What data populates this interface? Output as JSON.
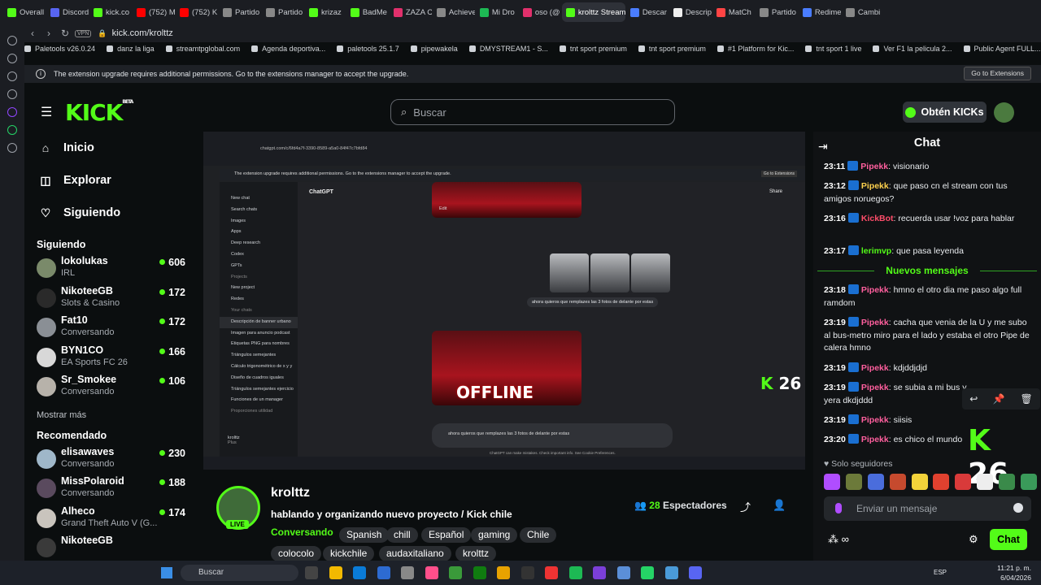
{
  "browser": {
    "tabs": [
      "Overall",
      "Discord",
      "kick.co",
      "(752) M",
      "(752) K",
      "Partido",
      "Partido",
      "krizaz",
      "BadMe",
      "ZAZA C",
      "Achieve",
      "Mi Dro",
      "oso (@",
      "krolttz Stream",
      "Descar",
      "Descrip",
      "MatCh",
      "Partido",
      "Redime",
      "Cambi"
    ],
    "active_tab_index": 13,
    "url": "kick.com/krolttz",
    "vpn_label": "VPN",
    "bookmarks": [
      "Paletools v26.0.24",
      "danz la liga",
      "streamtpglobal.com",
      "Agenda deportiva...",
      "paletools 25.1.7",
      "pipewakela",
      "DMYSTREAM1 - S...",
      "tnt sport premium",
      "tnt sport premium",
      "#1 Platform for Kic...",
      "tnt sport 1 live",
      "Ver F1 la pelicula 2...",
      "Public Agent FULL..."
    ],
    "extension_notice": "The extension upgrade requires additional permissions. Go to the extensions manager to accept the upgrade.",
    "extension_button": "Go to Extensions"
  },
  "kick": {
    "logo": "KICK",
    "logo_beta": "BETA",
    "search_placeholder": "Buscar",
    "get_kicks": "Obtén KICKs",
    "nav": [
      {
        "label": "Inicio",
        "icon": "home-icon"
      },
      {
        "label": "Explorar",
        "icon": "compass-icon"
      },
      {
        "label": "Siguiendo",
        "icon": "heart-icon"
      }
    ],
    "following_title": "Siguiendo",
    "following": [
      {
        "name": "lokolukas",
        "category": "IRL",
        "viewers": "606",
        "color": "#7a8a6a"
      },
      {
        "name": "NikoteeGB",
        "category": "Slots & Casino",
        "viewers": "172",
        "color": "#2a2a2a"
      },
      {
        "name": "Fat10",
        "category": "Conversando",
        "viewers": "172",
        "color": "#8a8f95"
      },
      {
        "name": "BYN1CO",
        "category": "EA Sports FC 26",
        "viewers": "166",
        "color": "#d8d8d8"
      },
      {
        "name": "Sr_Smokee",
        "category": "Conversando",
        "viewers": "106",
        "color": "#b7b2aa"
      }
    ],
    "show_more": "Mostrar más",
    "recommended_title": "Recomendado",
    "recommended": [
      {
        "name": "elisawaves",
        "category": "Conversando",
        "viewers": "230",
        "color": "#9fb7c9"
      },
      {
        "name": "MissPolaroid",
        "category": "Conversando",
        "viewers": "188",
        "color": "#5a4a5e"
      },
      {
        "name": "Alheco",
        "category": "Grand Theft Auto V (G...",
        "viewers": "174",
        "color": "#c9c4bd"
      },
      {
        "name": "NikoteeGB",
        "category": "",
        "viewers": "",
        "color": "#3a3a3a"
      }
    ]
  },
  "video": {
    "inner_url": "chatgpt.com/c/6fd4a7f-3390-8589-a5a0-84f47c7bfd84",
    "gpt_title": "ChatGPT",
    "gpt_share": "Share",
    "gpt_sidebar": [
      "New chat",
      "Search chats",
      "Images",
      "Apps",
      "Deep research",
      "Codex",
      "GPTs",
      "Projects",
      "New project",
      "Redes",
      "Your chats",
      "Descripción de banner urbano",
      "Imagen para anuncio podcast",
      "Etiquetas PNG para nombres",
      "Triángulos semejantes",
      "Cálculo trigonométrico de x y y",
      "Diseño de cuadros iguales",
      "Triángulos semejantes ejercicio",
      "Funciones de un manager",
      "Proporciones utilidad"
    ],
    "gpt_user": "krolttz",
    "gpt_plan": "Plus",
    "gpt_edit": "Edit",
    "gpt_message": "ahora quieros que remplazes las 3 fotos de delante por estas",
    "gpt_banner_text": "OFFLINE",
    "gpt_input": "ahora quieros que remplazes las 3 fotos de delante por estas",
    "gpt_disclaimer": "ChatGPT can make mistakes. Check important info. See Cookie Preferences.",
    "kick_count": "26"
  },
  "stream": {
    "name": "krolttz",
    "live": "LIVE",
    "title": "hablando y organizando nuevo proyecto / Kick chile",
    "category": "Conversando",
    "tags": [
      "Spanish",
      "chill",
      "Español",
      "gaming",
      "Chile",
      "colocolo",
      "kickchile",
      "audaxitaliano",
      "krolttz"
    ],
    "viewers": "28",
    "viewers_label": "Espectadores"
  },
  "chat": {
    "title": "Chat",
    "new_messages": "Nuevos mensajes",
    "messages": [
      {
        "time": "23:11",
        "user": "Pipekk",
        "text": "visionario",
        "color": "#ff5f9e"
      },
      {
        "time": "23:12",
        "user": "Pipekk",
        "text": "que paso cn el stream con tus amigos noruegos?",
        "color": "#ffd24d"
      },
      {
        "time": "23:16",
        "user": "KickBot",
        "text": "recuerda usar !voz para hablar",
        "color": "#ff4d6a"
      },
      {
        "time": "23:17",
        "user": "lerimvp",
        "text": "que pasa leyenda",
        "color": "#53fc18"
      },
      {
        "time": "23:18",
        "user": "Pipekk",
        "text": "hmno el otro dia me paso algo full ramdom",
        "color": "#ff5f9e"
      },
      {
        "time": "23:19",
        "user": "Pipekk",
        "text": "cacha que venia de la U y me subo al bus-metro miro para el lado y estaba el otro Pipe de calera hmno",
        "color": "#ff5f9e"
      },
      {
        "time": "23:19",
        "user": "Pipekk",
        "text": "kdjddjdjd",
        "color": "#ff5f9e"
      },
      {
        "time": "23:19",
        "user": "Pipekk",
        "text": "se subia a mi bus y",
        "text2": "yera dkdjddd",
        "color": "#ff5f9e"
      },
      {
        "time": "23:19",
        "user": "Pipekk",
        "text": "siisis",
        "color": "#ff5f9e"
      },
      {
        "time": "23:20",
        "user": "Pipekk",
        "text": "es chico el mundo",
        "color": "#ff5f9e"
      }
    ],
    "kick_count": "26",
    "followers_only": "Solo seguidores",
    "input_placeholder": "Enviar un mensaje",
    "send_label": "Chat"
  },
  "taskbar": {
    "search": "Buscar",
    "lang": "ESP",
    "time": "11:21 p. m.",
    "date": "6/04/2026"
  }
}
